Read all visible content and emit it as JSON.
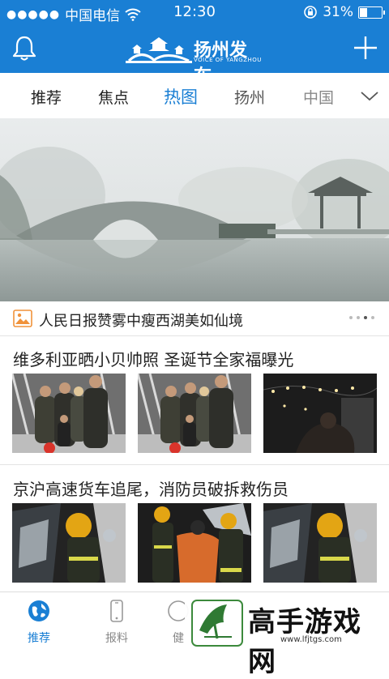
{
  "status": {
    "carrier": "中国电信",
    "time": "12:30",
    "battery": "31%",
    "battery_level": 0.31
  },
  "header": {
    "logo_name": "扬州发布",
    "logo_sub": "VOICE OF YANGZHOU"
  },
  "tabs": [
    {
      "label": "推荐"
    },
    {
      "label": "焦点"
    },
    {
      "label": "热图"
    },
    {
      "label": "扬州"
    },
    {
      "label": "中国"
    }
  ],
  "hero": {
    "caption": "人民日报赞雾中瘦西湖美如仙境",
    "pages": 4,
    "current_page": 3
  },
  "articles": [
    {
      "title": "维多利亚晒小贝帅照 圣诞节全家福曝光"
    },
    {
      "title": "京沪高速货车追尾，消防员破拆救伤员"
    }
  ],
  "tabbar": [
    {
      "label": "推荐"
    },
    {
      "label": "报料"
    },
    {
      "label": "健"
    }
  ],
  "watermark": {
    "text": "高手游戏网",
    "url": "www.lfjtgs.com"
  },
  "colors": {
    "brand": "#1a7fd4"
  }
}
